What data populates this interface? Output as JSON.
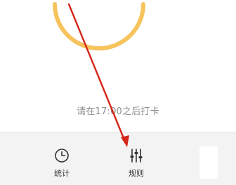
{
  "status": {
    "hint_text": "请在17:00之后打卡",
    "ring_color": "#f6c35c"
  },
  "tabbar": {
    "items": [
      {
        "label": "统计",
        "icon": "clock-icon"
      },
      {
        "label": "规则",
        "icon": "sliders-icon"
      }
    ],
    "partial_item_icon": "partial-tab-item"
  },
  "annotation": {
    "arrow_color": "#d62418"
  }
}
